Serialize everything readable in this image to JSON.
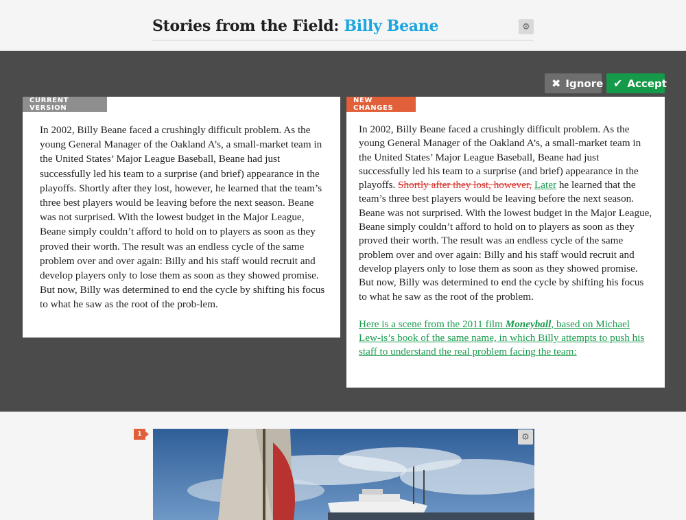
{
  "header": {
    "title_prefix": "Stories from the Field: ",
    "title_accent": "Billy Beane",
    "settings_icon": "gear-icon"
  },
  "actions": {
    "ignore_label": "Ignore",
    "ignore_icon": "close-icon",
    "accept_label": "Accept",
    "accept_icon": "check-icon"
  },
  "current": {
    "tag": "CURRENT VERSION",
    "text": "In 2002, Billy Beane faced a crushingly difficult problem. As the young General Manager of the Oakland A’s, a small-market team in the United States’ Major League Baseball, Beane had just successfully led his team to a surprise (and brief) appearance in the playoffs.  Shortly after they lost, however, he learned that the team’s three best players would be leaving before the next season. Beane was not surprised. With the lowest budget in the Major League, Beane simply couldn’t afford to hold on to players as soon as they proved their worth. The result was an endless cycle of the same problem over and over again: Billy and his staff would recruit and develop players only to lose them as soon as they showed promise. But now, Billy was determined to end the cycle by shifting his focus to what he saw as the root of the prob-lem."
  },
  "changes": {
    "tag": "NEW CHANGES",
    "text_before": "In 2002, Billy Beane faced a crushingly difficult problem. As the young General Manager of the Oakland A’s, a small-market team in the United States’ Major League Baseball, Beane had just successfully led his team to a surprise (and brief) appearance in the playoffs. ",
    "deleted": "Shortly after they lost, however,",
    "inserted": "Later",
    "text_after": " he learned that the team’s three best players would be leaving before the next season. Beane was not surprised. With the lowest budget in the Major League, Beane simply couldn’t afford to hold on to players as soon as they proved their worth. The result was an endless cycle of the same problem over and over again: Billy and his staff would recruit and develop players only to lose them as soon as they showed promise. But now, Billy was determined to end the cycle by shifting his focus to what he saw as the root of the problem.",
    "new_para_before": "Here is a scene from the 2011 film ",
    "new_para_em": "Moneyball",
    "new_para_after": ", based on Michael Lew-is’s book of the same name, in which Billy attempts to push his staff to understand the real problem facing the team:"
  },
  "figure": {
    "marker": "1",
    "settings_icon": "gear-icon"
  },
  "colors": {
    "accent_blue": "#1aa6e0",
    "accept_green": "#159a49",
    "deleted_red": "#d8312b",
    "inserted_green": "#179b4c",
    "new_tag_orange": "#e1603a",
    "band_gray": "#4b4b4b"
  }
}
